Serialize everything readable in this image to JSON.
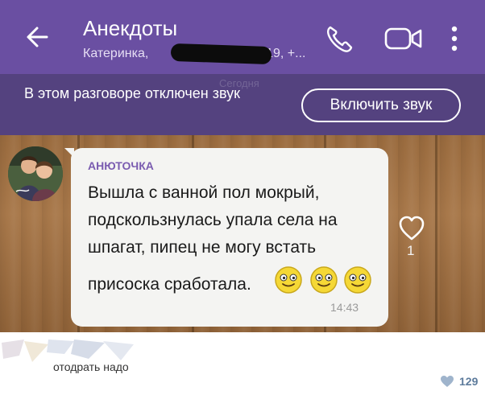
{
  "header": {
    "title": "Анекдоты",
    "subtitle_prefix": "Катеринка,",
    "subtitle_suffix": "719, +...",
    "back_icon": "arrow-left-icon",
    "call_icon": "phone-icon",
    "video_icon": "video-camera-icon",
    "menu_icon": "more-vertical-icon"
  },
  "banner": {
    "muted_text": "В этом разговоре отключен звук",
    "unmute_label": "Включить звук",
    "ghost_date": "Сегодня"
  },
  "message": {
    "sender": "АНЮТОЧКА",
    "lines": [
      "Вышла с ванной пол мокрый,",
      "подскользнулась упала села на",
      "шпагат, пипец не могу встать",
      "присоска сработала."
    ],
    "time": "14:43",
    "emoji_icon": "smiley-face-icon",
    "like_count": "1"
  },
  "comment": {
    "text": "отодрать надо",
    "likes": "129"
  },
  "colors": {
    "header": "#6a4fa2",
    "banner": "#54427f",
    "sender": "#7a5cb0",
    "bubble": "#f4f4f2",
    "likes": "#5d7b9c"
  }
}
